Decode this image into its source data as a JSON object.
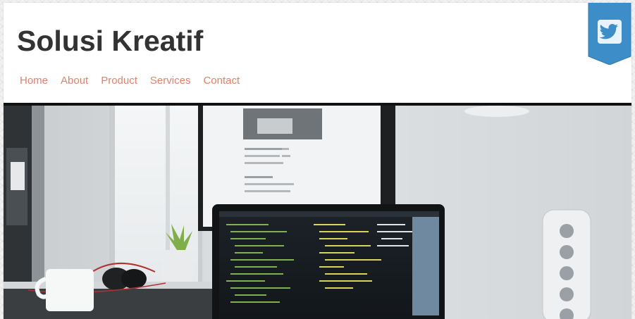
{
  "header": {
    "site_title": "Solusi Kreatif",
    "nav": [
      {
        "label": "Home"
      },
      {
        "label": "About"
      },
      {
        "label": "Product"
      },
      {
        "label": "Services"
      },
      {
        "label": "Contact"
      }
    ]
  },
  "social": {
    "icon": "twitter-icon",
    "badge_color": "#3d8ec8"
  },
  "hero": {
    "image": "desk-with-laptop-showing-code-photo"
  },
  "colors": {
    "nav_link": "#e3806c",
    "title": "#333333",
    "hero_border": "#111111"
  }
}
